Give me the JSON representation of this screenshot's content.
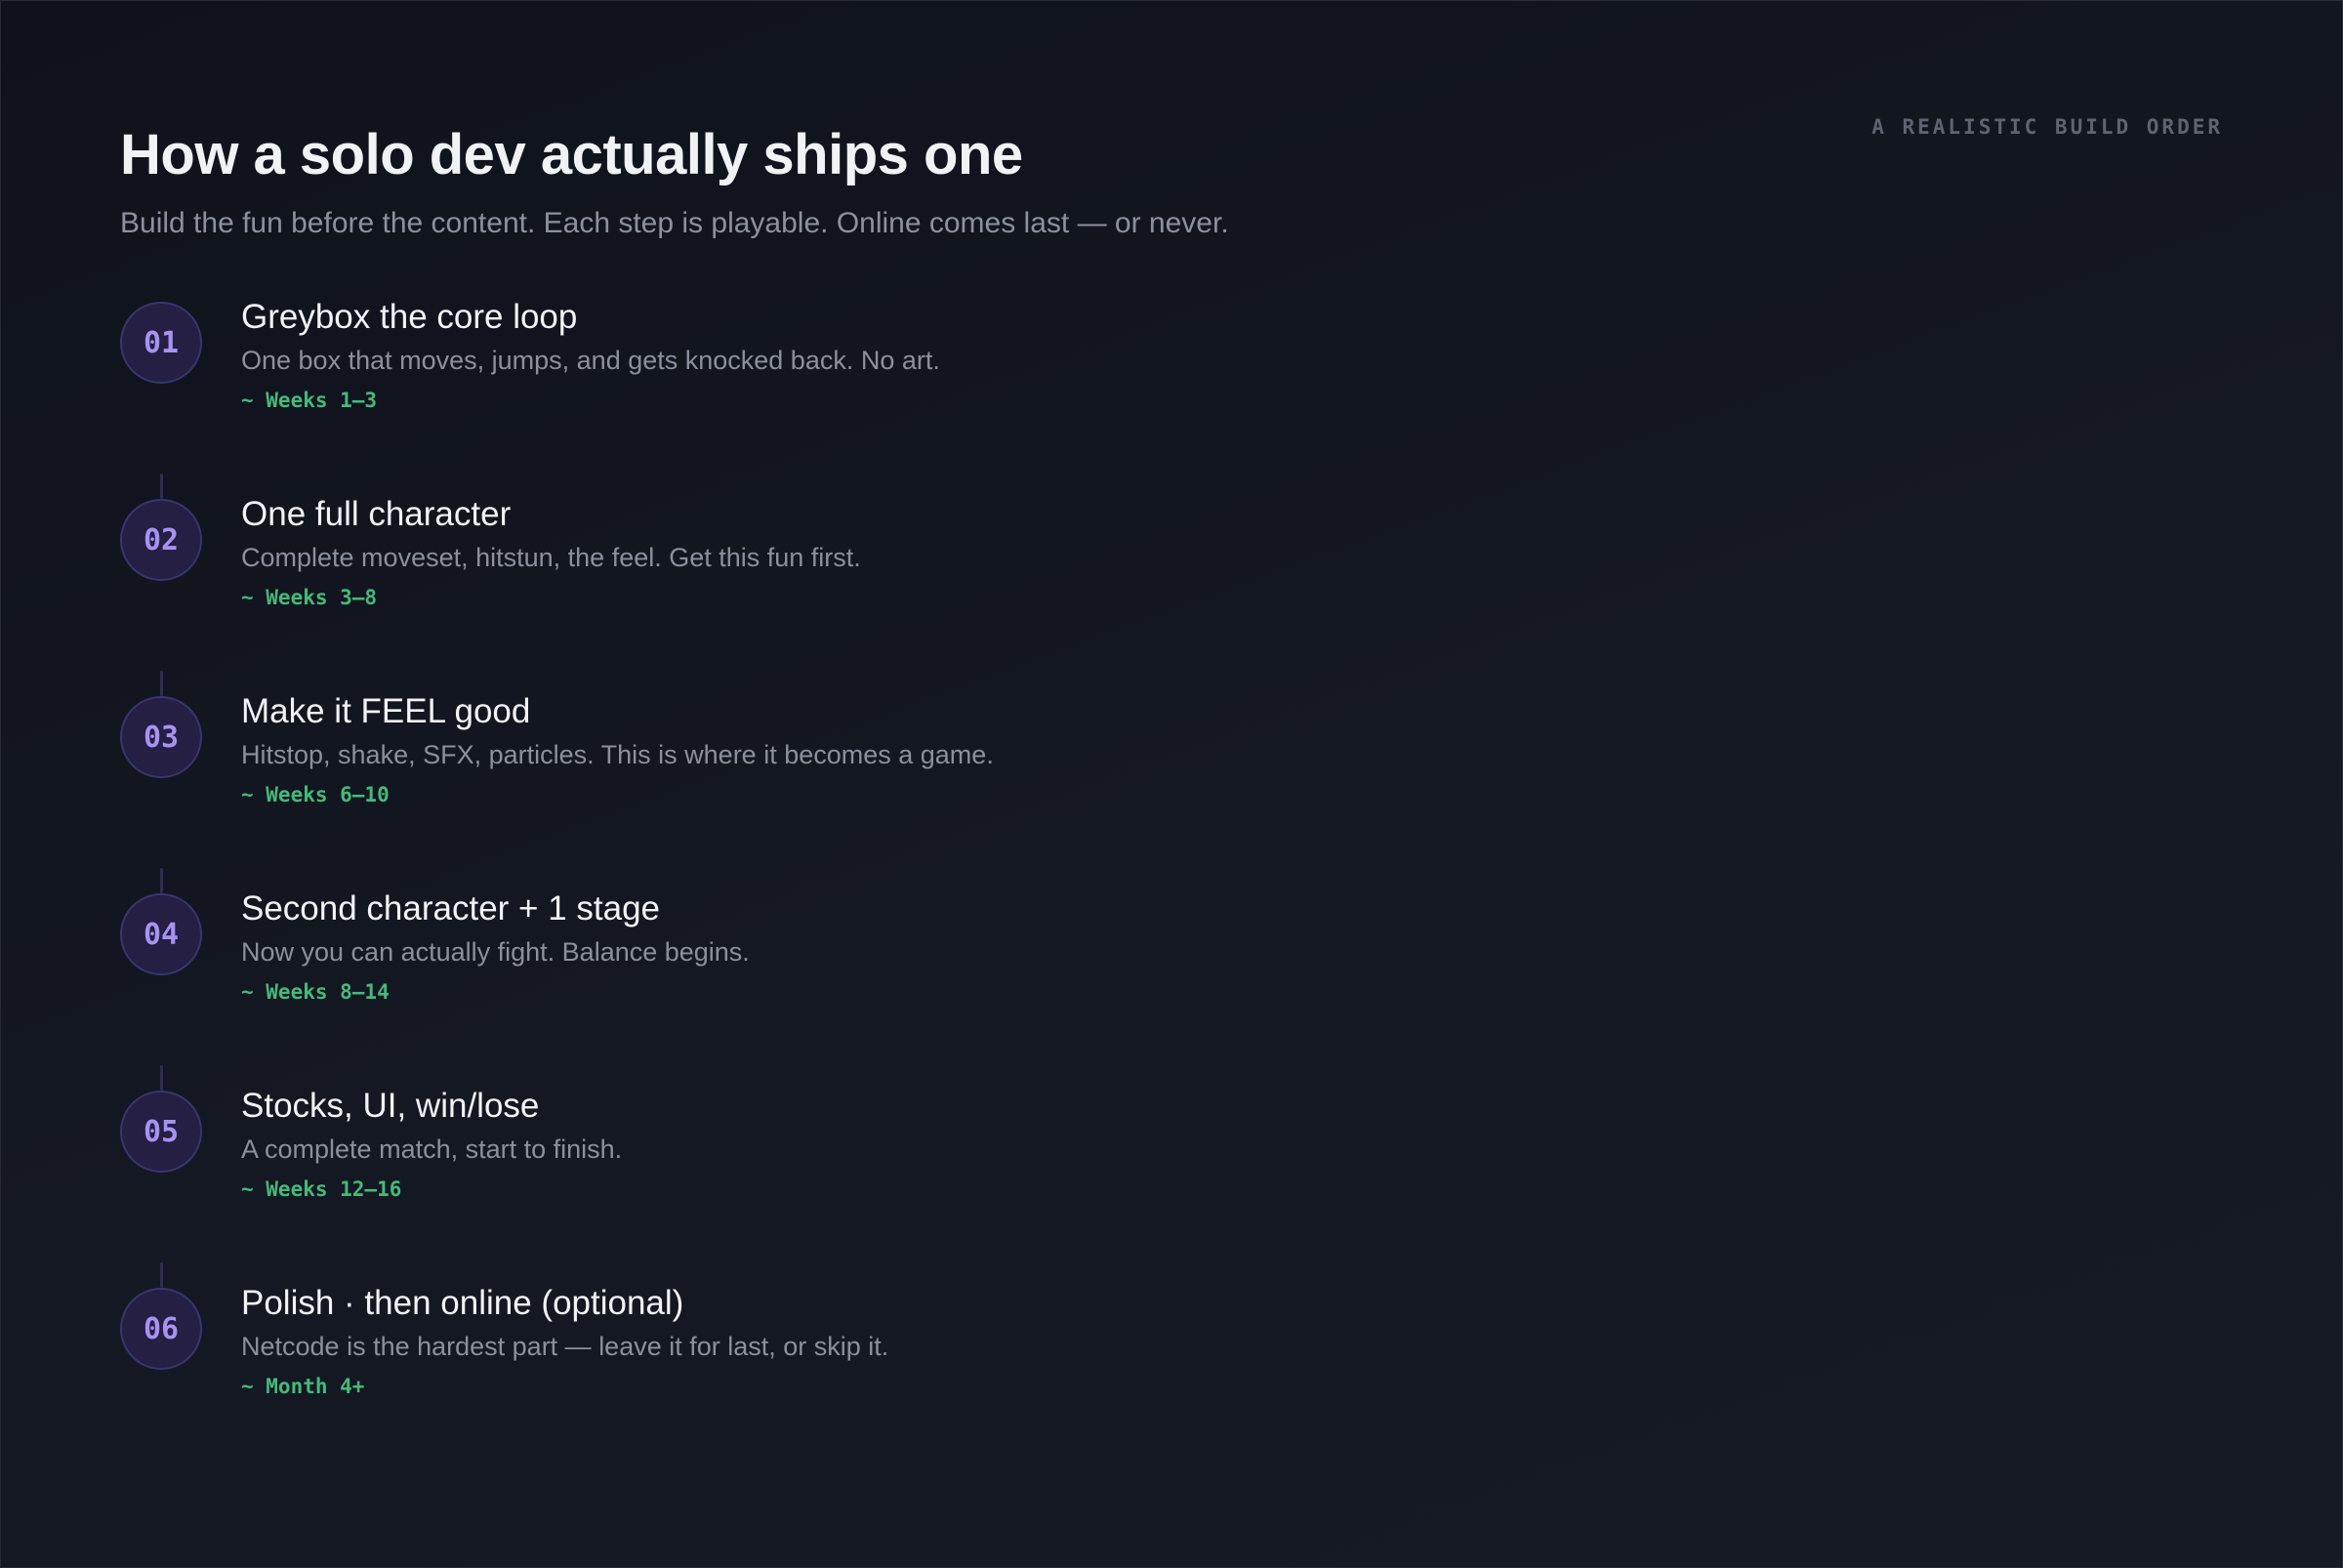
{
  "header": {
    "title": "How a solo dev actually ships one",
    "subtitle": "Build the fun before the content. Each step is playable. Online comes last — or never.",
    "eyebrow": "A REALISTIC BUILD ORDER"
  },
  "steps": [
    {
      "number": "01",
      "title": "Greybox the core loop",
      "description": "One box that moves, jumps, and gets knocked back. No art.",
      "timeframe": "~ Weeks 1–3"
    },
    {
      "number": "02",
      "title": "One full character",
      "description": "Complete moveset, hitstun, the feel. Get this fun first.",
      "timeframe": "~ Weeks 3–8"
    },
    {
      "number": "03",
      "title": "Make it FEEL good",
      "description": "Hitstop, shake, SFX, particles. This is where it becomes a game.",
      "timeframe": "~ Weeks 6–10"
    },
    {
      "number": "04",
      "title": "Second character + 1 stage",
      "description": "Now you can actually fight. Balance begins.",
      "timeframe": "~ Weeks 8–14"
    },
    {
      "number": "05",
      "title": "Stocks, UI, win/lose",
      "description": "A complete match, start to finish.",
      "timeframe": "~ Weeks 12–16"
    },
    {
      "number": "06",
      "title": "Polish · then online (optional)",
      "description": "Netcode is the hardest part — leave it for last, or skip it.",
      "timeframe": "~ Month 4+"
    }
  ],
  "colors": {
    "accent": "#a792f2",
    "circle_fill": "#241f43",
    "timeframe": "#45b97a",
    "background": "#12151e"
  }
}
